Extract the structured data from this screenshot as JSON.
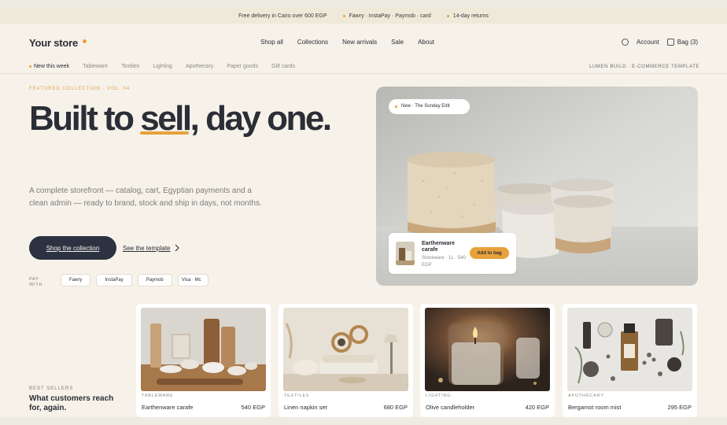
{
  "promo": {
    "delivery": "Free delivery in Cairo over 600 EGP",
    "payments": "Fawry · InstaPay · Paymob · card",
    "returns": "14-day returns"
  },
  "header": {
    "logo": "Your store",
    "nav": [
      "Shop all",
      "Collections",
      "New arrivals",
      "Sale",
      "About"
    ],
    "account": "Account",
    "bag": "Bag (3)"
  },
  "categories": {
    "items": [
      "New this week",
      "Tableware",
      "Textiles",
      "Lighting",
      "Apothecary",
      "Paper goods",
      "Gift cards"
    ],
    "template_label": "LUMEN BUILD · E-COMMERCE TEMPLATE"
  },
  "hero": {
    "eyebrow": "FEATURED COLLECTION · VOL. 04",
    "title_a": "Built to ",
    "title_b": "sell",
    "title_c": ", day one.",
    "description": "A complete storefront — catalog, cart, Egyptian payments and a clean admin — ready to brand, stock and ship in days, not months.",
    "cta_primary": "Shop the collection",
    "cta_secondary": "See the template",
    "pay_label": "PAY WITH",
    "pay_methods": [
      "Fawry",
      "InstaPay",
      "Paymob",
      "Visa · Mc"
    ],
    "badge": "New · The Sunday Edit",
    "product": {
      "name": "Earthenware carafe",
      "meta": "Stoneware · 1L · 540 EGP",
      "button": "Add to bag"
    }
  },
  "bestsellers": {
    "eyebrow": "BEST SELLERS",
    "title": "What customers reach for, again.",
    "cards": [
      {
        "category": "TABLEWARE",
        "name": "Earthenware carafe",
        "price": "540 EGP"
      },
      {
        "category": "TEXTILES",
        "name": "Linen napkin set",
        "price": "680 EGP"
      },
      {
        "category": "LIGHTING",
        "name": "Olive candleholder",
        "price": "420 EGP"
      },
      {
        "category": "APOTHECARY",
        "name": "Bergamot room mist",
        "price": "295 EGP"
      }
    ]
  },
  "colors": {
    "accent": "#e9a13b",
    "ink": "#2b2e36",
    "cta_bg": "#2c3241",
    "background": "#f6f2ea"
  }
}
